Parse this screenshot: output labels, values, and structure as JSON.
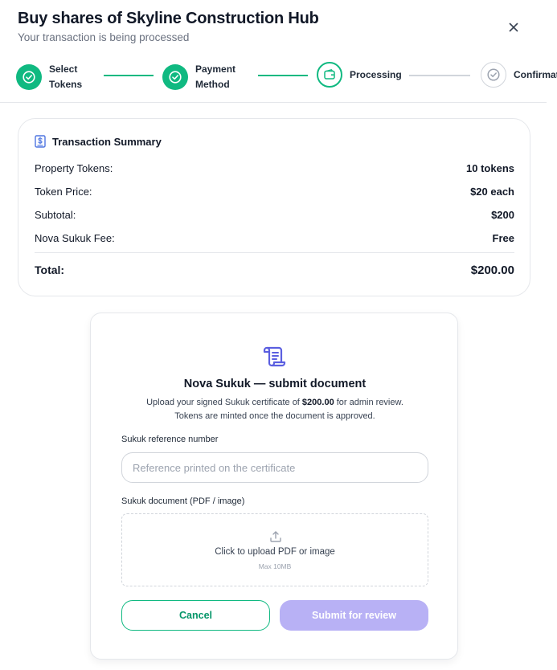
{
  "header": {
    "title": "Buy shares of Skyline Construction Hub",
    "subtitle": "Your transaction is being processed",
    "close_icon": "close-icon"
  },
  "stepper": {
    "steps": [
      {
        "label": "Select Tokens",
        "status": "done",
        "icon": "check-circle-icon"
      },
      {
        "label": "Payment Method",
        "status": "done",
        "icon": "check-circle-icon"
      },
      {
        "label": "Processing",
        "status": "current",
        "icon": "wallet-icon"
      },
      {
        "label": "Confirmat",
        "status": "pending",
        "icon": "check-circle-icon"
      }
    ]
  },
  "summary": {
    "heading": "Transaction Summary",
    "icon": "dollar-document-icon",
    "rows": [
      {
        "label": "Property Tokens:",
        "value": "10 tokens"
      },
      {
        "label": "Token Price:",
        "value": "$20 each"
      },
      {
        "label": "Subtotal:",
        "value": "$200"
      },
      {
        "label": "Nova Sukuk Fee:",
        "value": "Free"
      }
    ],
    "total_label": "Total:",
    "total_value": "$200.00"
  },
  "document": {
    "icon": "scroll-icon",
    "title": "Nova Sukuk — submit document",
    "desc_prefix": "Upload your signed Sukuk certificate of ",
    "desc_amount": "$200.00",
    "desc_suffix": " for admin review.",
    "desc_line2": "Tokens are minted once the document is approved.",
    "ref_label": "Sukuk reference number",
    "ref_value": "",
    "ref_placeholder": "Reference printed on the certificate",
    "file_label": "Sukuk document (PDF / image)",
    "upload_text": "Click to upload PDF or image",
    "upload_hint": "Max 10MB",
    "upload_icon": "upload-icon",
    "cancel_label": "Cancel",
    "submit_label": "Submit for review"
  },
  "colors": {
    "accent_green": "#10b981",
    "submit_disabled": "#b8b1f5",
    "icon_purple": "#6366f1"
  }
}
